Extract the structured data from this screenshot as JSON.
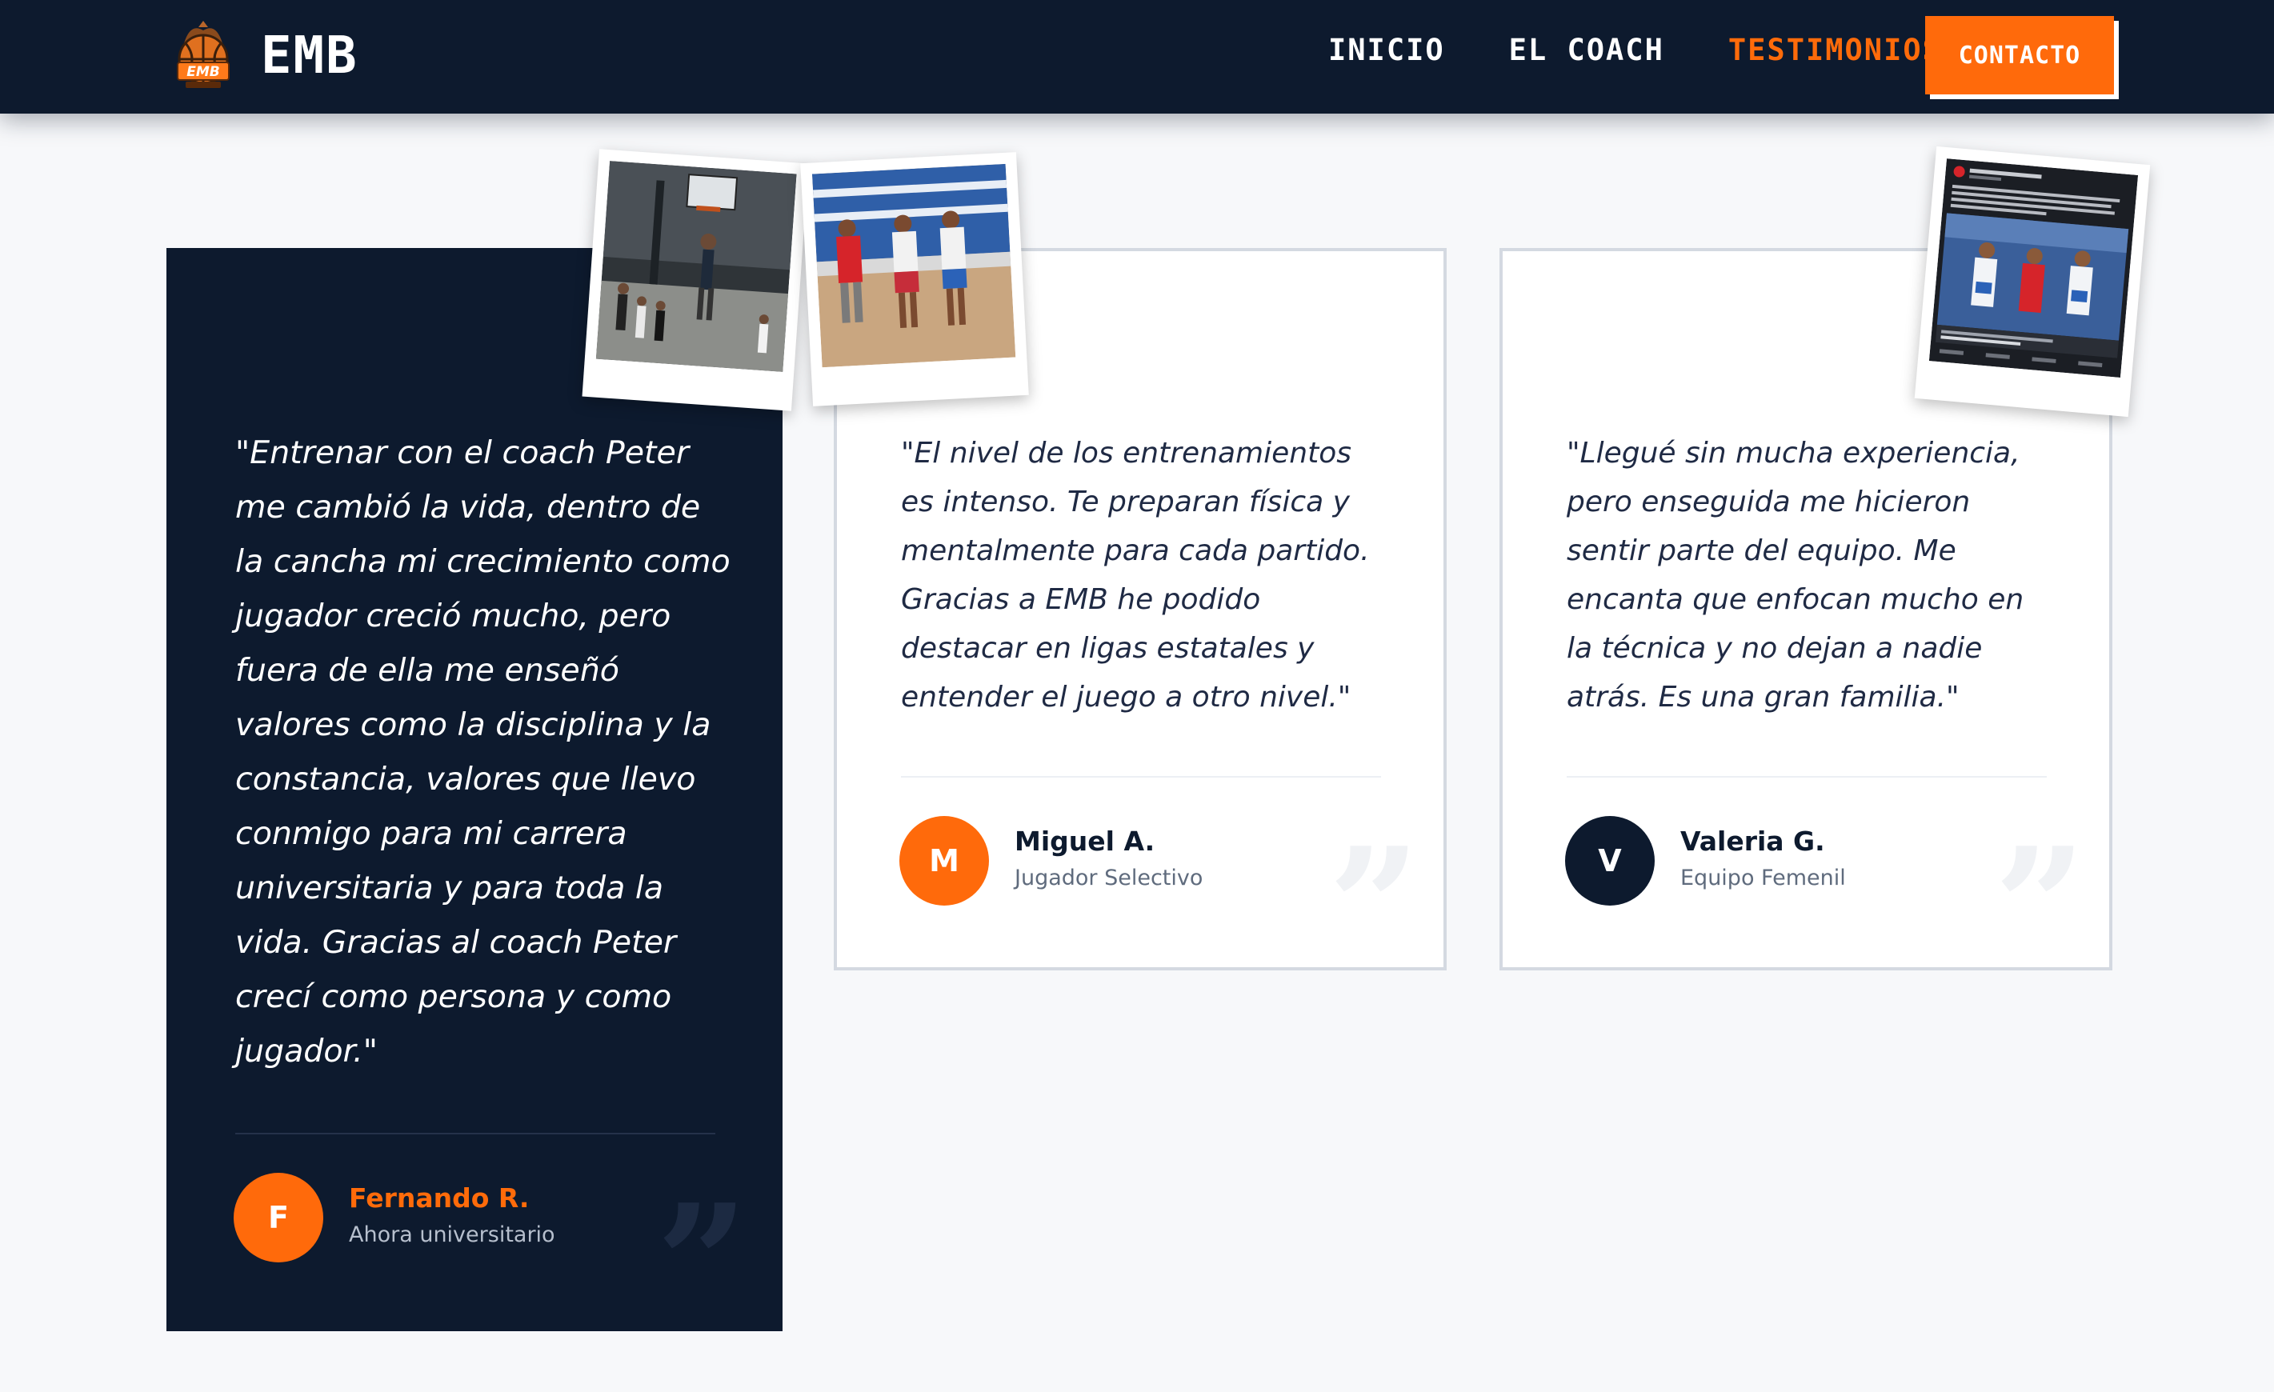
{
  "nav": {
    "brand": "EMB",
    "links": [
      {
        "label": "INICIO",
        "active": false
      },
      {
        "label": "EL COACH",
        "active": false
      },
      {
        "label": "TESTIMONIOS",
        "active": true
      }
    ],
    "cta_label": "CONTACTO"
  },
  "testimonials": [
    {
      "quote": "\"Entrenar con el coach Peter me cambió la vida, dentro de la cancha mi crecimiento como jugador creció mucho, pero fuera de ella me enseñó valores como la disciplina y la constancia, valores que llevo conmigo para mi carrera universitaria y para toda la vida. Gracias al coach Peter crecí como persona y como jugador.\"",
      "initial": "F",
      "name": "Fernando R.",
      "role": "Ahora universitario"
    },
    {
      "quote": "\"El nivel de los entrenamientos es intenso. Te preparan física y mentalmente para cada partido. Gracias a EMB he podido destacar en ligas estatales y entender el juego a otro nivel.\"",
      "initial": "M",
      "name": "Miguel A.",
      "role": "Jugador Selectivo"
    },
    {
      "quote": "\"Llegué sin mucha experiencia, pero enseguida me hicieron sentir parte del equipo. Me encanta que enfocan mucho en la técnica y no dejan a nadie atrás. Es una gran familia.\"",
      "initial": "V",
      "name": "Valeria G.",
      "role": "Equipo Femenil"
    }
  ],
  "quote_glyph": "”",
  "colors": {
    "navy": "#0d1a2e",
    "orange": "#ff6a0b",
    "card_border": "#d4d9e1",
    "page_bg": "#f7f8fa"
  },
  "icons": {
    "brand_logo": "basketball-crest-icon",
    "quote": "closing-quote-icon"
  }
}
